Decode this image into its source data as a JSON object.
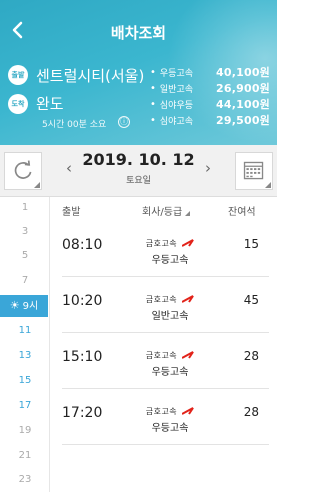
{
  "header": {
    "title": "배차조회",
    "departure_badge": "출발",
    "arrival_badge": "도착",
    "departure": "센트럴시티(서울)",
    "arrival": "완도",
    "duration": "5시간 00분 소요",
    "info_icon": "ⓘ",
    "fares": [
      {
        "label": "우등고속",
        "price": "40,100원"
      },
      {
        "label": "일반고속",
        "price": "26,900원"
      },
      {
        "label": "심야우등",
        "price": "44,100원"
      },
      {
        "label": "심야고속",
        "price": "29,500원"
      }
    ]
  },
  "datebar": {
    "date": "2019. 10. 12",
    "weekday": "토요일",
    "prev": "‹",
    "next": "›"
  },
  "hours": {
    "h1": "1",
    "h3": "3",
    "h5": "5",
    "h7": "7",
    "current": "9시",
    "h11": "11",
    "h13": "13",
    "h15": "15",
    "h17": "17",
    "h19": "19",
    "h21": "21",
    "h23": "23"
  },
  "table": {
    "col_departure": "출발",
    "col_company": "회사/등급",
    "col_seats": "잔여석",
    "rows": [
      {
        "time": "08:10",
        "company": "금호고속",
        "grade": "우등고속",
        "seats": "15"
      },
      {
        "time": "10:20",
        "company": "금호고속",
        "grade": "일반고속",
        "seats": "45"
      },
      {
        "time": "15:10",
        "company": "금호고속",
        "grade": "우등고속",
        "seats": "28"
      },
      {
        "time": "17:20",
        "company": "금호고속",
        "grade": "우등고속",
        "seats": "28"
      }
    ]
  },
  "colors": {
    "header": "#2fa9c4",
    "accent": "#3aa6d8",
    "logo_red": "#e2231a"
  }
}
